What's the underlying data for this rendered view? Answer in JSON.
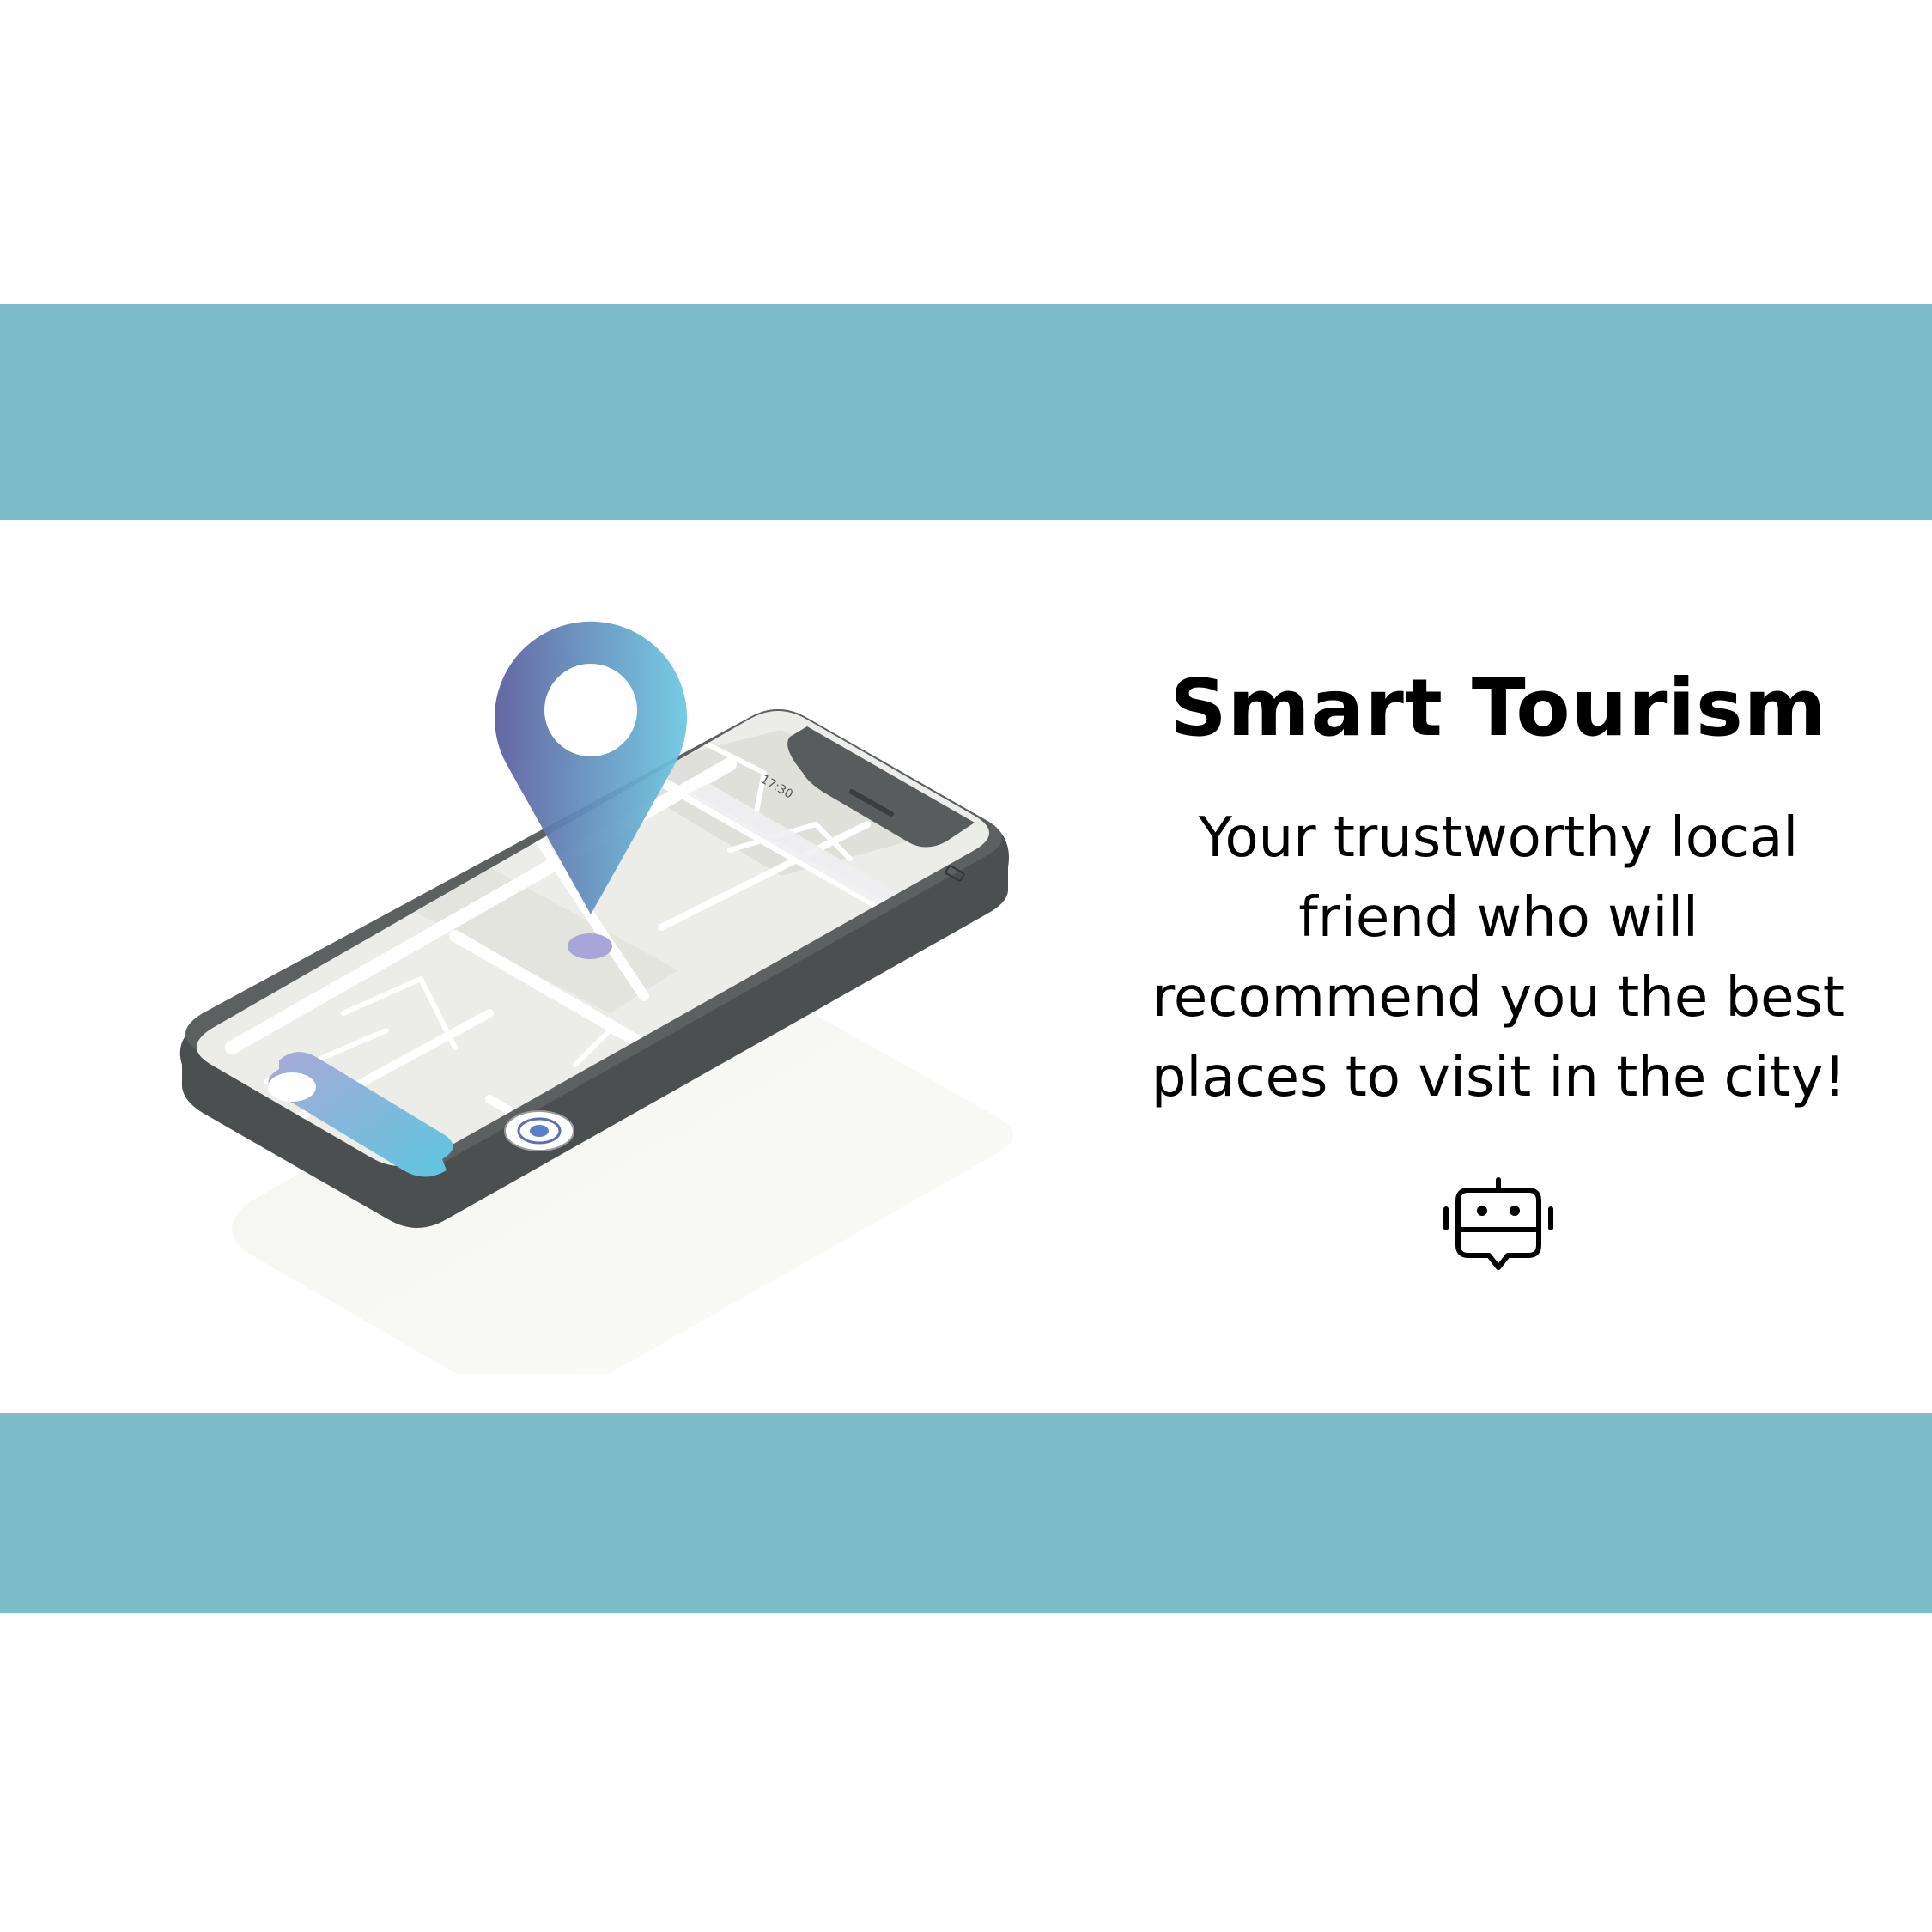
{
  "colors": {
    "band": "#7dbdca",
    "background": "#ffffff",
    "pin_gradient_start": "#5b5c9c",
    "pin_gradient_end": "#6cc8e3",
    "phone_frame": "#585c5d",
    "map_surface": "#e8e8e4",
    "text": "#000000"
  },
  "illustration": {
    "phone_status_time": "17:30",
    "icons": [
      "location-pin-icon",
      "smartphone-map",
      "current-location-icon"
    ]
  },
  "content": {
    "title": "Smart Tourism",
    "tagline_lines": [
      "Your trustworthy local",
      "friend who will",
      "recommend you the best",
      "places to visit in the city!"
    ],
    "icon": "robot-chat-icon"
  }
}
